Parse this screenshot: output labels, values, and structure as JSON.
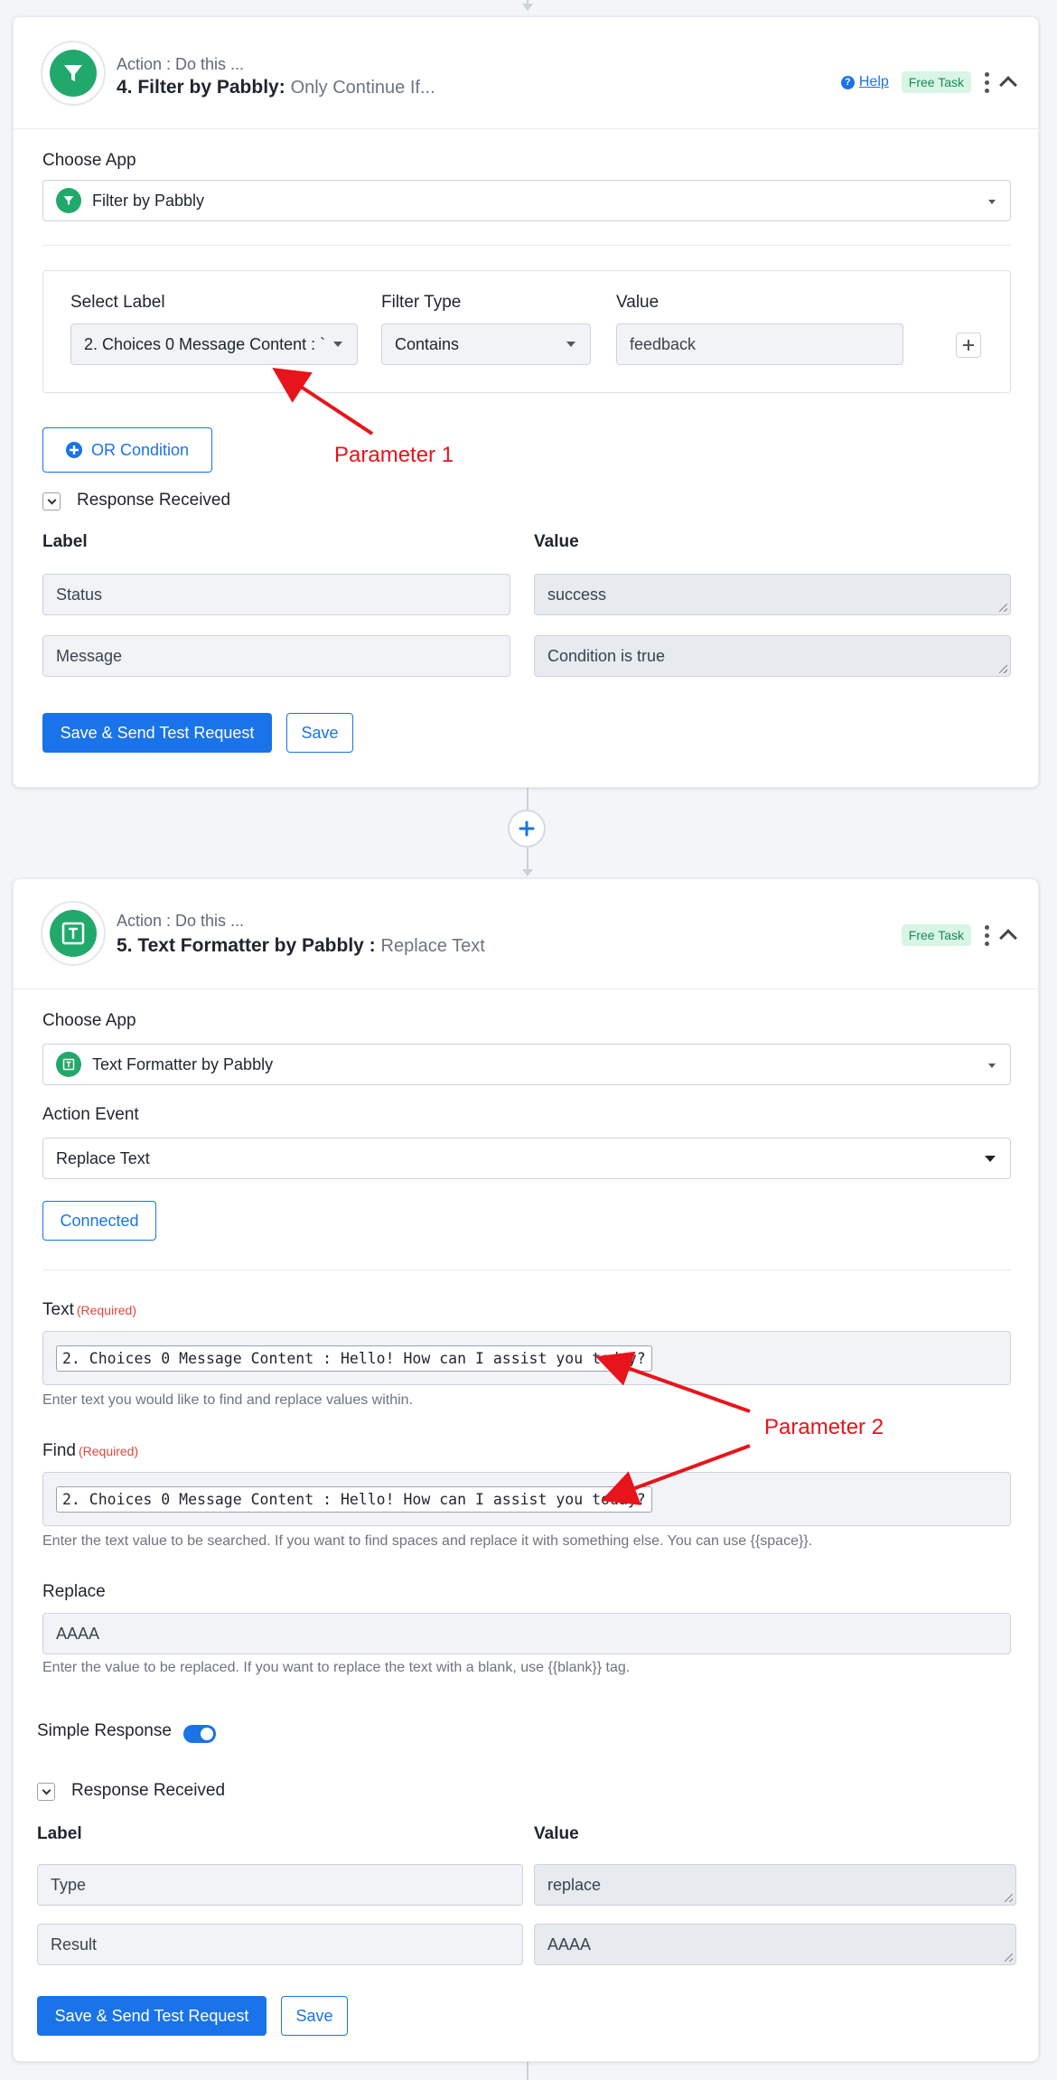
{
  "step4": {
    "action_sub": "Action : Do this ...",
    "title": "4. Filter by Pabbly:",
    "title_sub": "Only Continue If...",
    "help_label": "Help",
    "free_task": "Free Task",
    "choose_app_label": "Choose App",
    "app_value": "Filter by Pabbly",
    "filter": {
      "select_label_header": "Select Label",
      "filter_type_header": "Filter Type",
      "value_header": "Value",
      "select_label_value": "2. Choices 0 Message Content : `",
      "filter_type_value": "Contains",
      "value_value": "feedback"
    },
    "or_condition": "OR Condition",
    "response_received": "Response Received",
    "label_header": "Label",
    "value_header": "Value",
    "rows": [
      {
        "label": "Status",
        "value": "success"
      },
      {
        "label": "Message",
        "value": "Condition is true"
      }
    ],
    "save_send": "Save & Send Test Request",
    "save": "Save"
  },
  "step5": {
    "action_sub": "Action : Do this ...",
    "title": "5. Text Formatter by Pabbly :",
    "title_sub": "Replace Text",
    "free_task": "Free Task",
    "choose_app_label": "Choose App",
    "app_value": "Text Formatter by Pabbly",
    "action_event_label": "Action Event",
    "action_event_value": "Replace Text",
    "connected": "Connected",
    "text_label": "Text",
    "required": "(Required)",
    "text_chip": "2. Choices 0 Message Content : Hello! How can I assist you today?",
    "text_hint": "Enter text you would like to find and replace values within.",
    "find_label": "Find",
    "find_chip": "2. Choices 0 Message Content : Hello! How can I assist you today?",
    "find_hint": "Enter the text value to be searched. If you want to find spaces and replace it with something else. You can use {{space}}.",
    "replace_label": "Replace",
    "replace_value": "AAAA",
    "replace_hint": "Enter the value to be replaced. If you want to replace the text with a blank, use {{blank}} tag.",
    "simple_response": "Simple Response",
    "response_received": "Response Received",
    "label_header": "Label",
    "value_header": "Value",
    "rows": [
      {
        "label": "Type",
        "value": "replace"
      },
      {
        "label": "Result",
        "value": "AAAA"
      }
    ],
    "save_send": "Save & Send Test Request",
    "save": "Save"
  },
  "annotations": {
    "param1": "Parameter 1",
    "param2": "Parameter 2"
  },
  "colors": {
    "primary": "#1a73e8",
    "app_green": "#21a96b",
    "annotation_red": "#e8141b"
  }
}
